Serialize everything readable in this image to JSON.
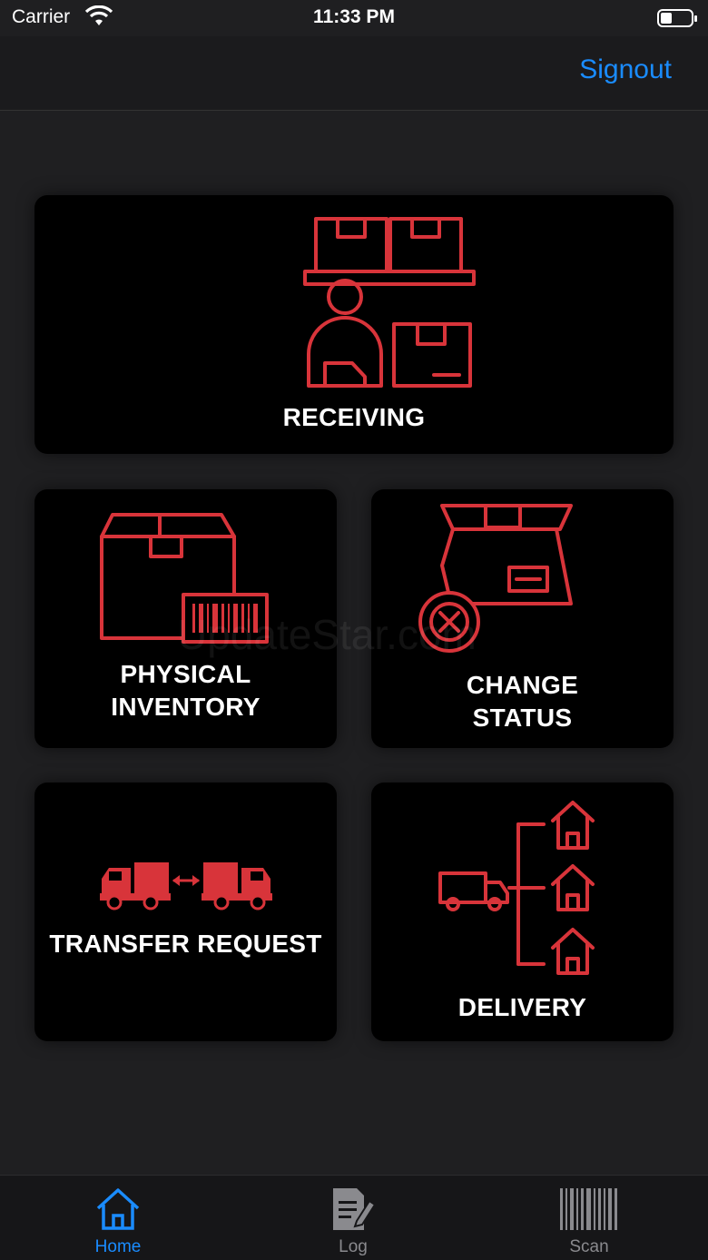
{
  "status_bar": {
    "carrier": "Carrier",
    "time": "11:33 PM"
  },
  "nav": {
    "signout_label": "Signout"
  },
  "tiles": {
    "receiving": {
      "label": "RECEIVING",
      "icon": "receiving-icon"
    },
    "physical_inventory": {
      "label_line1": "PHYSICAL",
      "label_line2": "INVENTORY",
      "icon": "inventory-barcode-icon"
    },
    "change_status": {
      "label_line1": "CHANGE",
      "label_line2": "STATUS",
      "icon": "box-cancel-icon"
    },
    "transfer_request": {
      "label": "TRANSFER REQUEST",
      "icon": "trucks-transfer-icon"
    },
    "delivery": {
      "label": "DELIVERY",
      "icon": "truck-houses-icon"
    }
  },
  "watermark": "UpdateStar.com",
  "tab_bar": {
    "tabs": [
      {
        "label": "Home",
        "icon": "home-icon",
        "active": true
      },
      {
        "label": "Log",
        "icon": "log-edit-icon",
        "active": false
      },
      {
        "label": "Scan",
        "icon": "barcode-icon",
        "active": false
      }
    ]
  },
  "colors": {
    "accent": "#1a8cff",
    "icon_red": "#d8343a",
    "tile_bg": "#000000",
    "page_bg": "#1f1f21"
  }
}
